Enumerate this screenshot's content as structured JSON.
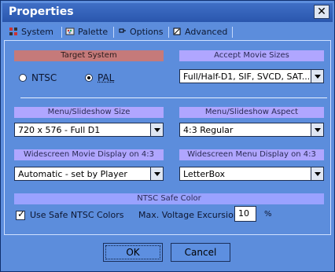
{
  "window": {
    "title": "Properties",
    "close_icon": "close-icon"
  },
  "tabs": [
    {
      "label": "System",
      "icon": "system-icon"
    },
    {
      "label": "Palette",
      "icon": "palette-icon"
    },
    {
      "label": "Options",
      "icon": "options-icon"
    },
    {
      "label": "Advanced",
      "icon": "advanced-icon"
    }
  ],
  "target_system": {
    "title": "Target System",
    "options": [
      {
        "label": "NTSC",
        "selected": false
      },
      {
        "label": "PAL",
        "selected": true
      }
    ]
  },
  "accept_movie_sizes": {
    "title": "Accept Movie Sizes",
    "value": "Full/Half-D1, SIF, SVCD, SAT..."
  },
  "menu_slideshow_size": {
    "title": "Menu/Slideshow Size",
    "value": "720 x 576 - Full D1"
  },
  "menu_slideshow_aspect": {
    "title": "Menu/Slideshow Aspect",
    "value": "4:3  Regular"
  },
  "widescreen_movie_display": {
    "title": "Widescreen Movie Display on 4:3",
    "value": "Automatic - set by Player"
  },
  "widescreen_menu_display": {
    "title": "Widescreen Menu Display on 4:3",
    "value": "LetterBox"
  },
  "ntsc_safe_color": {
    "title": "NTSC Safe Color",
    "use_safe_colors_label": "Use Safe NTSC Colors",
    "use_safe_colors_checked": true,
    "max_voltage_label": "Max. Voltage Excursion",
    "max_voltage_value": "10",
    "percent_label": "%"
  },
  "buttons": {
    "ok": "OK",
    "cancel": "Cancel"
  },
  "colors": {
    "window_bg": "#5c8ddc",
    "title_bar": "#2a56ad",
    "label_bar": "#b0a6ff",
    "target_bar": "#c57a7a"
  }
}
